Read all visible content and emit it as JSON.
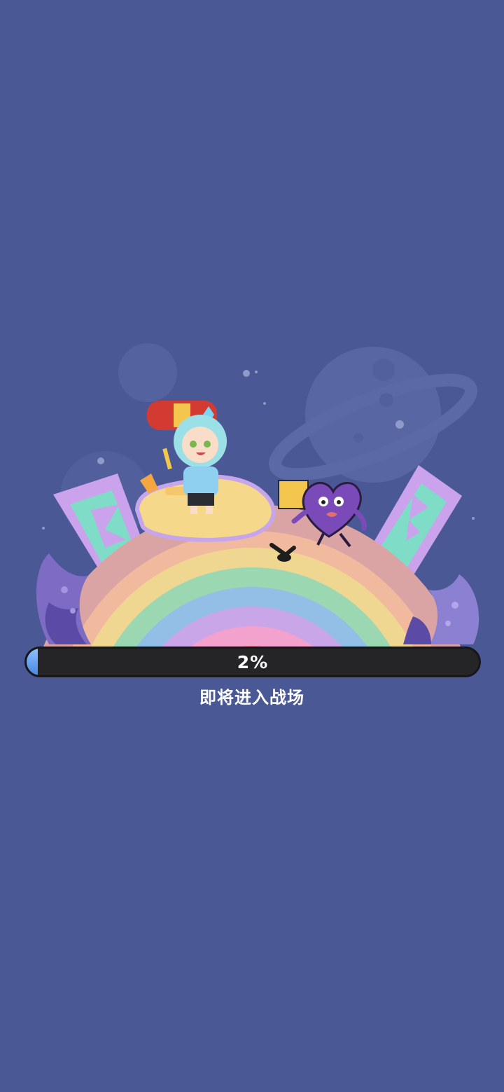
{
  "loading": {
    "percent_label": "2%",
    "progress": 0.02,
    "status": "即将进入战场"
  },
  "colors": {
    "background": "#4a5896",
    "bar_track": "#252527",
    "bar_fill": "#5a96ea"
  },
  "illustration": {
    "characters": [
      "hammer-hero",
      "purple-heart-creature"
    ]
  }
}
